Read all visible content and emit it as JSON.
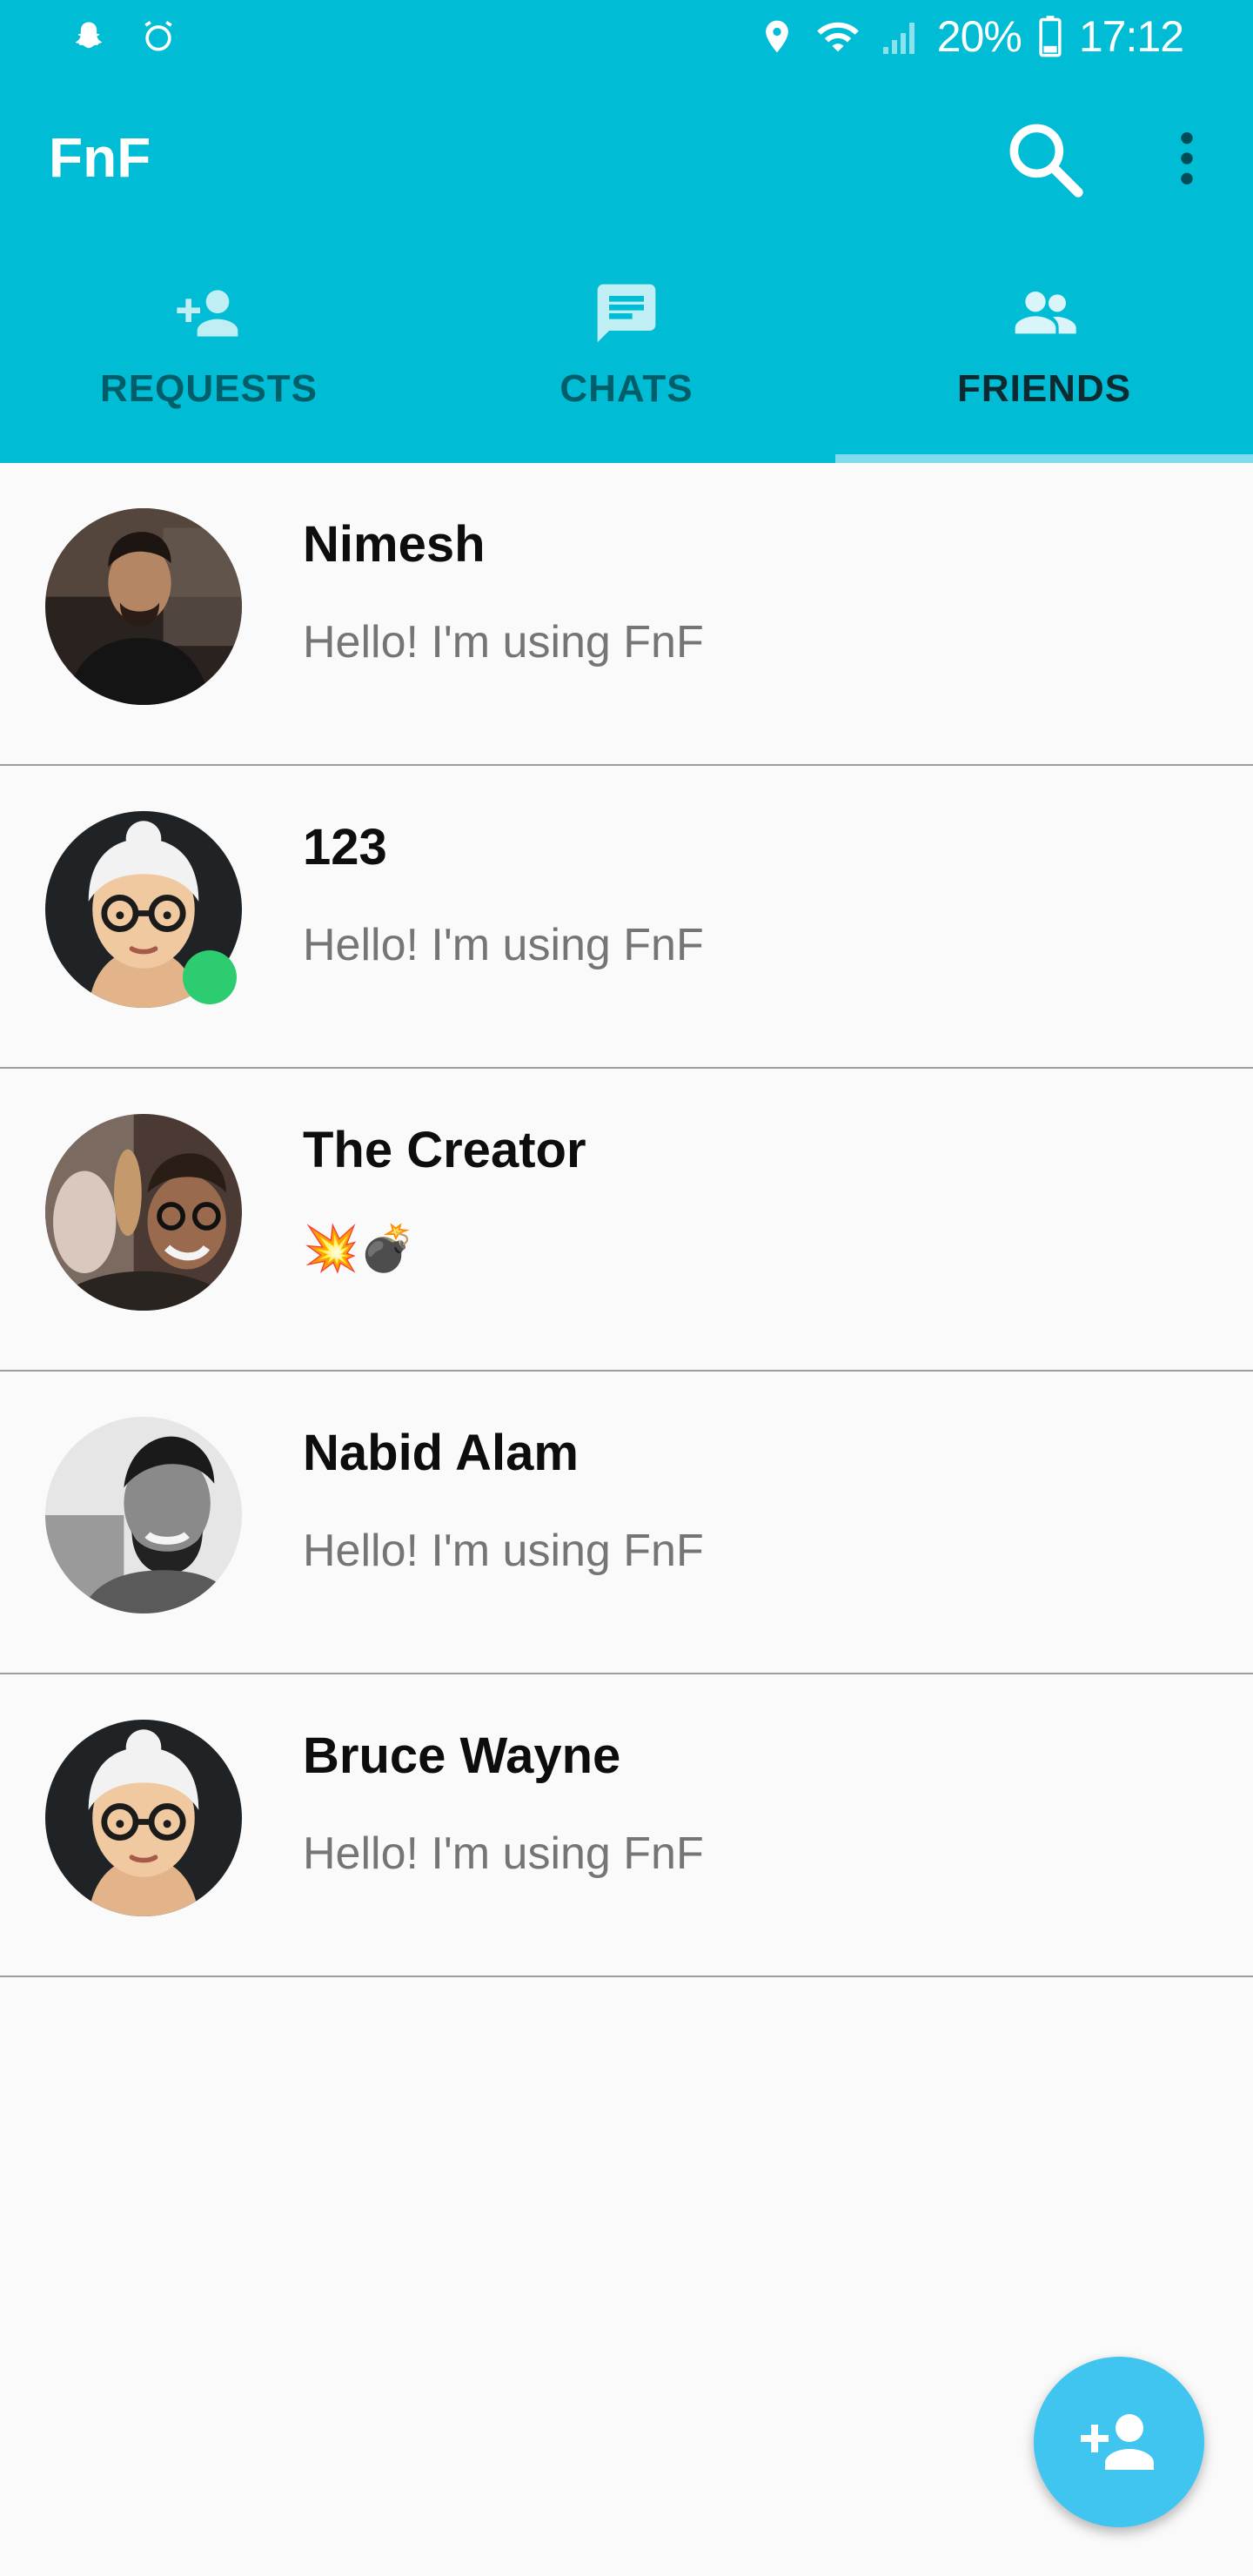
{
  "status_bar": {
    "battery": "20%",
    "time": "17:12"
  },
  "app_bar": {
    "title": "FnF",
    "search_icon": "search-icon",
    "more_icon": "more-vert-icon"
  },
  "tabs": [
    {
      "label": "REQUESTS",
      "icon": "person-add-icon",
      "active": false
    },
    {
      "label": "CHATS",
      "icon": "chat-icon",
      "active": false
    },
    {
      "label": "FRIENDS",
      "icon": "group-icon",
      "active": true
    }
  ],
  "friends": [
    {
      "name": "Nimesh",
      "status": "Hello! I'm using FnF",
      "online": false,
      "avatar": "photo"
    },
    {
      "name": "123",
      "status": "Hello! I'm using FnF",
      "online": true,
      "avatar": "default"
    },
    {
      "name": "The Creator",
      "status": "💥💣",
      "online": false,
      "avatar": "photo"
    },
    {
      "name": "Nabid Alam",
      "status": "Hello! I'm using FnF",
      "online": false,
      "avatar": "photo"
    },
    {
      "name": "Bruce Wayne",
      "status": "Hello! I'm using FnF",
      "online": false,
      "avatar": "default"
    }
  ],
  "fab": {
    "icon": "person-add-icon"
  },
  "colors": {
    "primary": "#00bcd4",
    "fab": "#40c4f0",
    "online": "#2ecc71"
  }
}
